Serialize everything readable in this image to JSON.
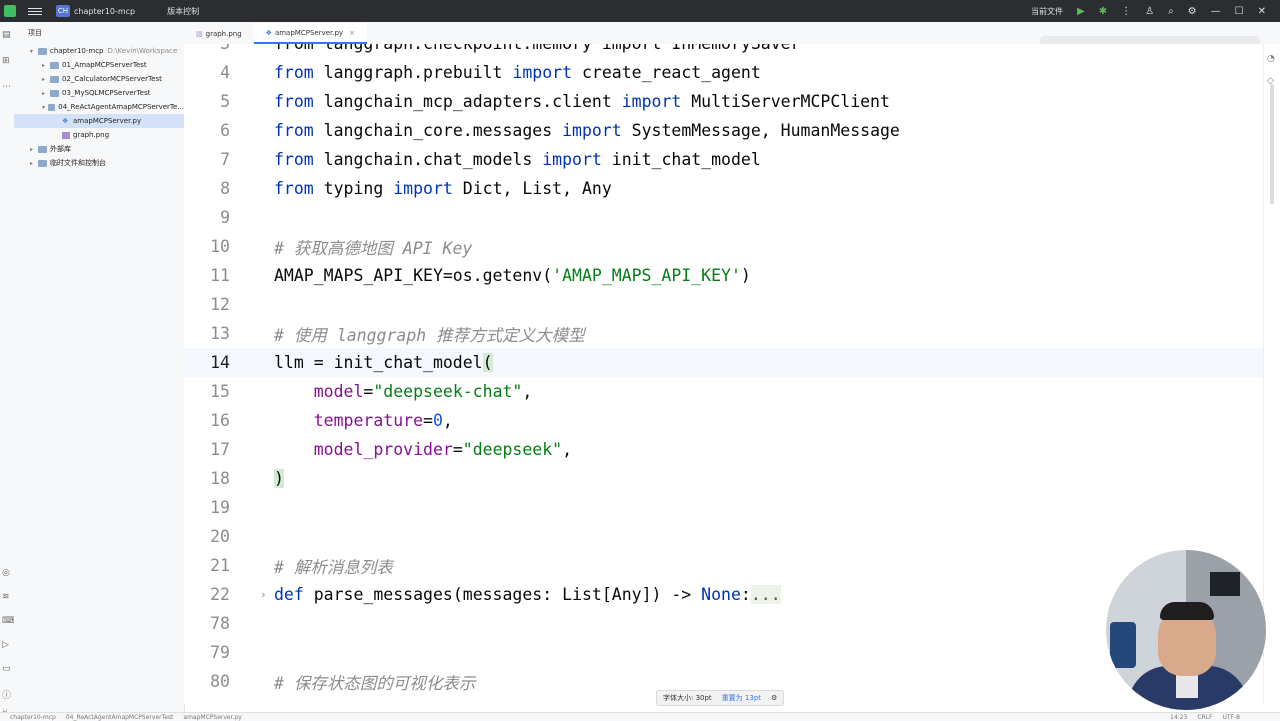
{
  "titlebar": {
    "project_badge": "CH",
    "project_name": "chapter10-mcp",
    "vcs_label": "版本控制",
    "current_file_label": "当前文件"
  },
  "project_panel": {
    "header": "项目",
    "items": [
      {
        "label": "chapter10-mcp",
        "path": "D:\\Kevin\\Workspace",
        "type": "folder",
        "indent": 0,
        "expanded": true
      },
      {
        "label": "01_AmapMCPServerTest",
        "type": "folder",
        "indent": 1,
        "expanded": false
      },
      {
        "label": "02_CalculatorMCPServerTest",
        "type": "folder",
        "indent": 1,
        "expanded": false
      },
      {
        "label": "03_MySQLMCPServerTest",
        "type": "folder",
        "indent": 1,
        "expanded": false
      },
      {
        "label": "04_ReActAgentAmapMCPServerTe...",
        "type": "folder",
        "indent": 1,
        "expanded": true
      },
      {
        "label": "amapMCPServer.py",
        "type": "py",
        "indent": 2,
        "selected": true
      },
      {
        "label": "graph.png",
        "type": "img",
        "indent": 2
      },
      {
        "label": "外部库",
        "type": "lib",
        "indent": 0,
        "expanded": false
      },
      {
        "label": "临时文件和控制台",
        "type": "scratch",
        "indent": 0,
        "expanded": false
      }
    ]
  },
  "tabs": [
    {
      "label": "graph.png",
      "icon": "image-icon",
      "active": false
    },
    {
      "label": "amapMCPServer.py",
      "icon": "python-file-icon",
      "active": true
    }
  ],
  "editor": {
    "lines": [
      {
        "num": "3",
        "partial": true,
        "segments": [
          {
            "t": "from langgraph.checkpoint.memory import InMemorySaver",
            "c": "plain"
          }
        ]
      },
      {
        "num": "4",
        "segments": [
          {
            "t": "from",
            "c": "kw"
          },
          {
            "t": " langgraph.prebuilt ",
            "c": "plain"
          },
          {
            "t": "import",
            "c": "kw"
          },
          {
            "t": " create_react_agent",
            "c": "plain"
          }
        ]
      },
      {
        "num": "5",
        "segments": [
          {
            "t": "from",
            "c": "kw"
          },
          {
            "t": " langchain_mcp_adapters.client ",
            "c": "plain"
          },
          {
            "t": "import",
            "c": "kw"
          },
          {
            "t": " MultiServerMCPClient",
            "c": "plain"
          }
        ]
      },
      {
        "num": "6",
        "segments": [
          {
            "t": "from",
            "c": "kw"
          },
          {
            "t": " langchain_core.messages ",
            "c": "plain"
          },
          {
            "t": "import",
            "c": "kw"
          },
          {
            "t": " SystemMessage, HumanMessage",
            "c": "plain"
          }
        ]
      },
      {
        "num": "7",
        "segments": [
          {
            "t": "from",
            "c": "kw"
          },
          {
            "t": " langchain.chat_models ",
            "c": "plain"
          },
          {
            "t": "import",
            "c": "kw"
          },
          {
            "t": " init_chat_model",
            "c": "plain"
          }
        ]
      },
      {
        "num": "8",
        "segments": [
          {
            "t": "from",
            "c": "kw"
          },
          {
            "t": " typing ",
            "c": "plain"
          },
          {
            "t": "import",
            "c": "kw"
          },
          {
            "t": " Dict, List, Any",
            "c": "plain"
          }
        ]
      },
      {
        "num": "9",
        "segments": []
      },
      {
        "num": "10",
        "segments": [
          {
            "t": "# 获取高德地图 API Key",
            "c": "cm"
          }
        ]
      },
      {
        "num": "11",
        "segments": [
          {
            "t": "AMAP_MAPS_API_KEY=os.getenv(",
            "c": "plain"
          },
          {
            "t": "'AMAP_MAPS_API_KEY'",
            "c": "str"
          },
          {
            "t": ")",
            "c": "plain"
          }
        ]
      },
      {
        "num": "12",
        "segments": []
      },
      {
        "num": "13",
        "segments": [
          {
            "t": "# 使用 langgraph 推荐方式定义大模型",
            "c": "cm"
          }
        ]
      },
      {
        "num": "14",
        "current": true,
        "segments": [
          {
            "t": "llm = init_chat_model",
            "c": "plain"
          },
          {
            "t": "(",
            "c": "brk"
          }
        ]
      },
      {
        "num": "15",
        "segments": [
          {
            "t": "    ",
            "c": "plain"
          },
          {
            "t": "model",
            "c": "prm"
          },
          {
            "t": "=",
            "c": "plain"
          },
          {
            "t": "\"deepseek-chat\"",
            "c": "str"
          },
          {
            "t": ",",
            "c": "plain"
          }
        ]
      },
      {
        "num": "16",
        "segments": [
          {
            "t": "    ",
            "c": "plain"
          },
          {
            "t": "temperature",
            "c": "prm"
          },
          {
            "t": "=",
            "c": "plain"
          },
          {
            "t": "0",
            "c": "num"
          },
          {
            "t": ",",
            "c": "plain"
          }
        ]
      },
      {
        "num": "17",
        "segments": [
          {
            "t": "    ",
            "c": "plain"
          },
          {
            "t": "model_provider",
            "c": "prm"
          },
          {
            "t": "=",
            "c": "plain"
          },
          {
            "t": "\"deepseek\"",
            "c": "str"
          },
          {
            "t": ",",
            "c": "plain"
          }
        ]
      },
      {
        "num": "18",
        "segments": [
          {
            "t": ")",
            "c": "brk"
          }
        ]
      },
      {
        "num": "19",
        "segments": []
      },
      {
        "num": "20",
        "segments": []
      },
      {
        "num": "21",
        "segments": [
          {
            "t": "# 解析消息列表",
            "c": "cm"
          }
        ]
      },
      {
        "num": "22",
        "fold": true,
        "segments": [
          {
            "t": "def",
            "c": "kw"
          },
          {
            "t": " parse_messages(messages: List[Any]) -> ",
            "c": "plain"
          },
          {
            "t": "None",
            "c": "kw"
          },
          {
            "t": ":",
            "c": "plain"
          },
          {
            "t": "...",
            "c": "ellipsis"
          }
        ]
      },
      {
        "num": "78",
        "segments": []
      },
      {
        "num": "79",
        "segments": []
      },
      {
        "num": "80",
        "segments": [
          {
            "t": "# 保存状态图的可视化表示",
            "c": "cm"
          }
        ]
      }
    ]
  },
  "font_tooltip": {
    "size_label": "字体大小: 30pt",
    "reset_label": "重置为 13pt"
  },
  "statusbar": {
    "breadcrumb": [
      "chapter10-mcp",
      "04_ReActAgentAmapMCPServerTest",
      "amapMCPServer.py"
    ],
    "position": "14:23",
    "line_ending": "CRLF",
    "encoding": "UTF-8"
  },
  "colors": {
    "keyword": "#0033b3",
    "string": "#067d17",
    "number": "#1750eb",
    "comment": "#8c8c8c",
    "param": "#871094",
    "accent": "#3574f0",
    "titlebar_bg": "#2b2d30"
  }
}
